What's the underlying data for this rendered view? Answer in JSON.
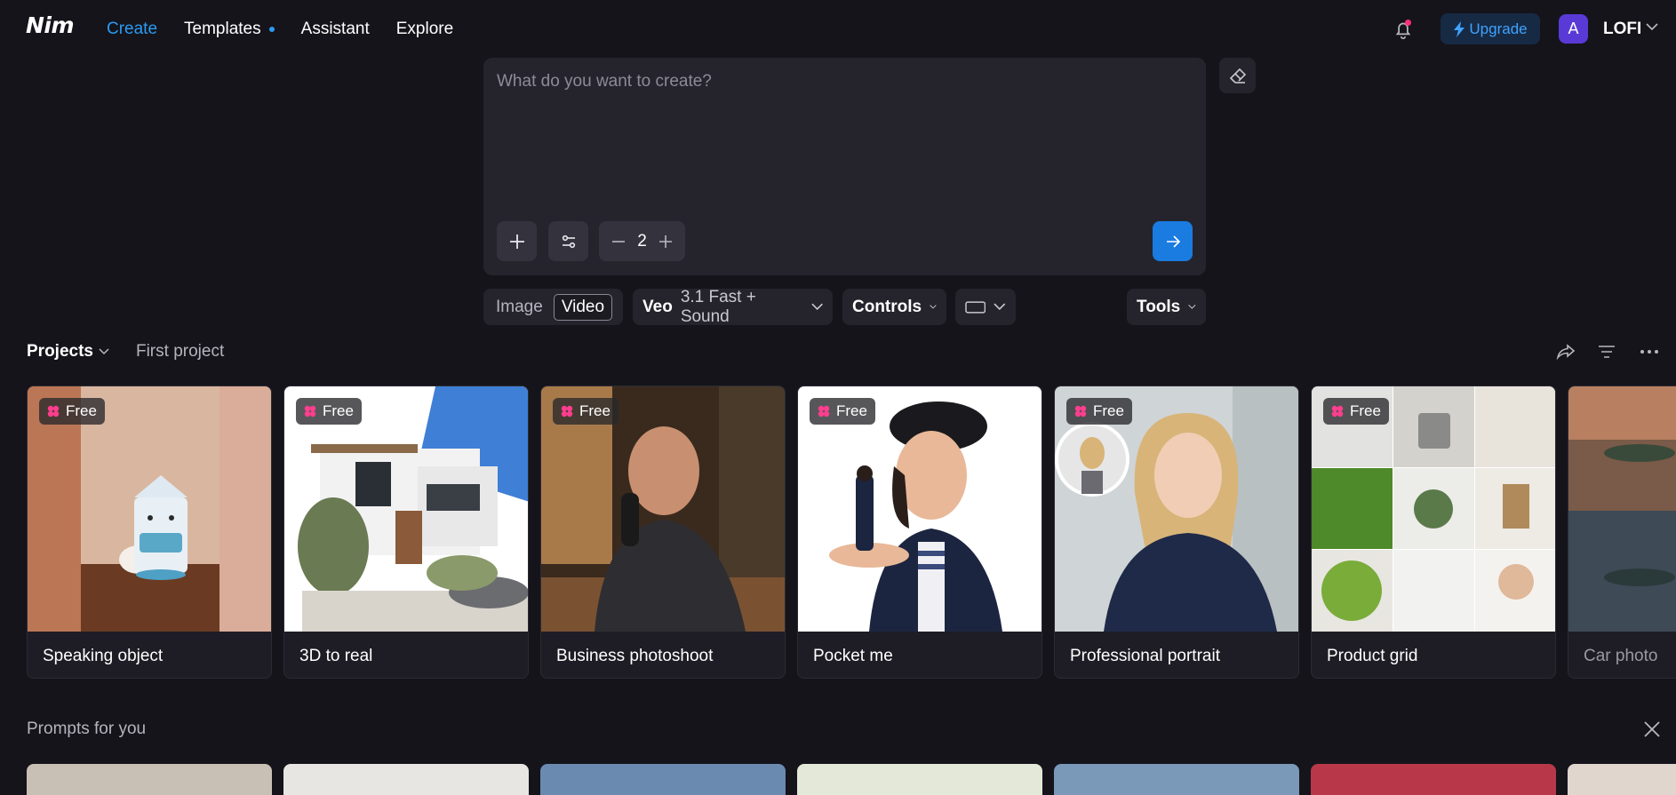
{
  "app": {
    "logo": "Nim"
  },
  "nav": {
    "items": [
      {
        "label": "Create",
        "active": true
      },
      {
        "label": "Templates",
        "dot": true
      },
      {
        "label": "Assistant"
      },
      {
        "label": "Explore"
      }
    ]
  },
  "header": {
    "upgrade_label": "Upgrade",
    "avatar_letter": "A",
    "username": "LOFI"
  },
  "prompt": {
    "placeholder": "What do you want to create?",
    "count": "2"
  },
  "options": {
    "modes": [
      "Image",
      "Video"
    ],
    "active_mode": "Video",
    "model_name": "Veo",
    "model_variant": "3.1 Fast + Sound",
    "controls_label": "Controls",
    "tools_label": "Tools"
  },
  "projects": {
    "label": "Projects",
    "current": "First project"
  },
  "templates": [
    {
      "label": "Speaking object",
      "badge": "Free"
    },
    {
      "label": "3D to real",
      "badge": "Free"
    },
    {
      "label": "Business photoshoot",
      "badge": "Free"
    },
    {
      "label": "Pocket me",
      "badge": "Free"
    },
    {
      "label": "Professional portrait",
      "badge": "Free"
    },
    {
      "label": "Product grid",
      "badge": "Free"
    },
    {
      "label": "Car photo",
      "badge": ""
    }
  ],
  "prompts_section": {
    "title": "Prompts for you"
  },
  "colors": {
    "background": "#15141b",
    "accent": "#2b9bf4",
    "send_button": "#1a7be0",
    "badge_icon": "#ff3e8e"
  }
}
